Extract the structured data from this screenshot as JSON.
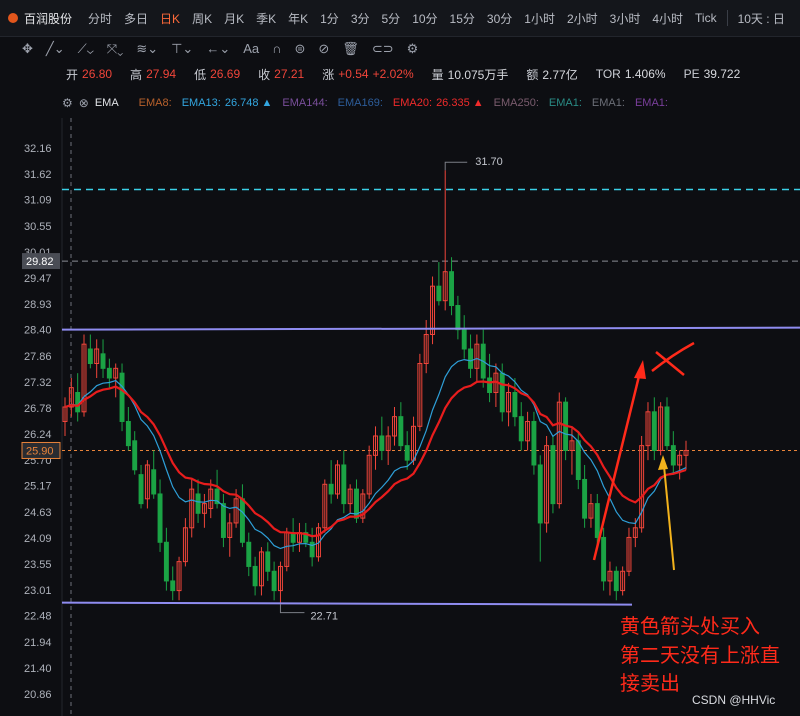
{
  "header": {
    "stock_name": "百润股份",
    "periods": [
      "分时",
      "多日",
      "日K",
      "周K",
      "月K",
      "季K",
      "年K",
      "1分",
      "3分",
      "5分",
      "10分",
      "15分",
      "30分",
      "1小时",
      "2小时",
      "3小时",
      "4小时",
      "Tick"
    ],
    "active_period": "日K",
    "range_label": "10天 : 日"
  },
  "quote": {
    "open_label": "开",
    "open": "26.80",
    "high_label": "高",
    "high": "27.94",
    "low_label": "低",
    "low": "26.69",
    "close_label": "收",
    "close": "27.21",
    "change_label": "涨",
    "change": "+0.54",
    "change_pct": "+2.02%",
    "volume_label": "量",
    "volume": "10.075万手",
    "amount_label": "额",
    "amount": "2.77亿",
    "turnover_label": "TOR",
    "turnover": "1.406%",
    "pe_label": "PE",
    "pe": "39.722"
  },
  "indicator": {
    "name": "EMA",
    "items": [
      {
        "label": "EMA8:",
        "value": "",
        "color": "#b8612c"
      },
      {
        "label": "EMA13:",
        "value": "26.748",
        "color": "#33a6e0",
        "arrow": "▲"
      },
      {
        "label": "EMA144:",
        "value": "",
        "color": "#7a4f9c"
      },
      {
        "label": "EMA169:",
        "value": "",
        "color": "#2d5d9a"
      },
      {
        "label": "EMA20:",
        "value": "26.335",
        "color": "#f02b2b",
        "arrow": "▲"
      },
      {
        "label": "EMA250:",
        "value": "",
        "color": "#7a5c6e"
      },
      {
        "label": "EMA1:",
        "value": "",
        "color": "#2a8c86"
      },
      {
        "label": "EMA1:",
        "value": "",
        "color": "#6c6f78"
      },
      {
        "label": "EMA1:",
        "value": "",
        "color": "#7a3f9c"
      }
    ]
  },
  "colors": {
    "up": "#f0453a",
    "down": "#1ba345",
    "ema13": "#2e9fd8",
    "ema20": "#e81d1d",
    "support": "#8f8cf0",
    "cyan": "#3bd0e6",
    "price": "#e8833a",
    "annot": "#ff2a1a",
    "yellow": "#f2b21c"
  },
  "chart_data": {
    "type": "candlestick",
    "y_ticks": [
      "32.16",
      "31.62",
      "31.09",
      "30.55",
      "30.01",
      "29.47",
      "28.93",
      "28.40",
      "27.86",
      "27.32",
      "26.78",
      "26.24",
      "25.70",
      "25.17",
      "24.63",
      "24.09",
      "23.55",
      "23.01",
      "22.48",
      "21.94",
      "21.40",
      "20.86"
    ],
    "ylim": [
      20.6,
      32.6
    ],
    "current_price": "25.90",
    "crosshair_price": "29.82",
    "high_label": "31.70",
    "low_label": "22.71",
    "h_levels": {
      "resistance": 28.4,
      "support": 22.71,
      "cyan": 31.3,
      "crosshair": 29.82,
      "current": 25.9
    },
    "ohlc": [
      [
        26.5,
        27.0,
        26.2,
        26.8
      ],
      [
        26.8,
        27.4,
        26.6,
        27.2
      ],
      [
        27.1,
        27.5,
        26.5,
        26.7
      ],
      [
        26.7,
        28.3,
        26.6,
        28.1
      ],
      [
        28.0,
        28.3,
        27.6,
        27.7
      ],
      [
        27.7,
        28.2,
        27.4,
        28.0
      ],
      [
        27.9,
        28.2,
        27.4,
        27.6
      ],
      [
        27.6,
        27.8,
        27.2,
        27.4
      ],
      [
        27.4,
        27.7,
        27.0,
        27.6
      ],
      [
        27.5,
        27.7,
        26.3,
        26.5
      ],
      [
        26.5,
        26.8,
        25.9,
        26.0
      ],
      [
        26.1,
        26.3,
        25.4,
        25.5
      ],
      [
        25.4,
        25.6,
        24.7,
        24.8
      ],
      [
        24.9,
        25.7,
        24.7,
        25.6
      ],
      [
        25.5,
        25.9,
        24.9,
        25.0
      ],
      [
        25.0,
        25.3,
        23.8,
        24.0
      ],
      [
        24.0,
        24.3,
        23.0,
        23.2
      ],
      [
        23.2,
        23.5,
        22.8,
        23.0
      ],
      [
        23.0,
        23.7,
        22.8,
        23.6
      ],
      [
        23.6,
        24.5,
        23.5,
        24.3
      ],
      [
        24.3,
        25.3,
        24.1,
        25.1
      ],
      [
        25.0,
        25.3,
        24.4,
        24.6
      ],
      [
        24.6,
        25.0,
        24.3,
        24.8
      ],
      [
        24.7,
        25.3,
        24.5,
        25.1
      ],
      [
        25.1,
        25.5,
        24.7,
        24.8
      ],
      [
        24.8,
        25.0,
        23.9,
        24.1
      ],
      [
        24.1,
        24.6,
        23.7,
        24.4
      ],
      [
        24.4,
        25.1,
        24.3,
        24.9
      ],
      [
        24.9,
        25.2,
        23.9,
        24.0
      ],
      [
        24.0,
        24.2,
        23.3,
        23.5
      ],
      [
        23.5,
        23.7,
        22.9,
        23.1
      ],
      [
        23.1,
        23.9,
        22.9,
        23.8
      ],
      [
        23.8,
        24.0,
        23.2,
        23.4
      ],
      [
        23.4,
        23.6,
        22.8,
        23.0
      ],
      [
        23.0,
        23.6,
        22.71,
        23.5
      ],
      [
        23.5,
        24.3,
        23.4,
        24.2
      ],
      [
        24.2,
        24.5,
        23.8,
        24.0
      ],
      [
        24.0,
        24.4,
        23.8,
        24.2
      ],
      [
        24.2,
        24.4,
        23.9,
        24.0
      ],
      [
        24.0,
        24.3,
        23.5,
        23.7
      ],
      [
        23.7,
        24.4,
        23.6,
        24.3
      ],
      [
        24.3,
        25.3,
        24.2,
        25.2
      ],
      [
        25.2,
        25.7,
        24.8,
        25.0
      ],
      [
        25.0,
        25.7,
        24.9,
        25.6
      ],
      [
        25.6,
        25.9,
        24.6,
        24.8
      ],
      [
        24.8,
        25.2,
        24.6,
        25.1
      ],
      [
        25.1,
        25.3,
        24.4,
        24.5
      ],
      [
        24.5,
        25.1,
        24.4,
        25.0
      ],
      [
        25.0,
        26.0,
        24.9,
        25.8
      ],
      [
        25.8,
        26.4,
        25.5,
        26.2
      ],
      [
        26.2,
        26.6,
        25.7,
        25.9
      ],
      [
        25.9,
        26.4,
        25.6,
        26.2
      ],
      [
        26.2,
        26.8,
        26.0,
        26.6
      ],
      [
        26.6,
        26.9,
        25.9,
        26.0
      ],
      [
        26.0,
        26.3,
        25.5,
        25.7
      ],
      [
        25.7,
        26.6,
        25.6,
        26.4
      ],
      [
        26.4,
        27.9,
        26.3,
        27.7
      ],
      [
        27.7,
        28.6,
        27.5,
        28.3
      ],
      [
        28.3,
        29.5,
        28.1,
        29.3
      ],
      [
        29.3,
        29.8,
        28.9,
        29.0
      ],
      [
        29.0,
        31.7,
        28.8,
        29.6
      ],
      [
        29.6,
        29.9,
        28.7,
        28.9
      ],
      [
        28.9,
        29.1,
        28.2,
        28.4
      ],
      [
        28.4,
        28.7,
        27.8,
        28.0
      ],
      [
        28.0,
        28.3,
        27.4,
        27.6
      ],
      [
        27.6,
        28.3,
        27.3,
        28.1
      ],
      [
        28.1,
        28.4,
        27.2,
        27.4
      ],
      [
        27.4,
        27.9,
        26.9,
        27.1
      ],
      [
        27.1,
        27.7,
        26.8,
        27.5
      ],
      [
        27.5,
        27.7,
        26.5,
        26.7
      ],
      [
        26.7,
        27.3,
        26.4,
        27.1
      ],
      [
        27.1,
        27.4,
        26.4,
        26.6
      ],
      [
        26.6,
        26.9,
        25.9,
        26.1
      ],
      [
        26.1,
        26.7,
        25.9,
        26.5
      ],
      [
        26.5,
        26.7,
        25.4,
        25.6
      ],
      [
        25.6,
        25.8,
        23.6,
        24.4
      ],
      [
        24.4,
        26.2,
        24.2,
        26.0
      ],
      [
        26.0,
        26.2,
        24.6,
        24.8
      ],
      [
        24.8,
        27.1,
        24.7,
        26.9
      ],
      [
        26.9,
        27.0,
        25.7,
        25.9
      ],
      [
        25.9,
        26.4,
        25.4,
        26.1
      ],
      [
        26.1,
        26.3,
        25.1,
        25.3
      ],
      [
        25.3,
        25.6,
        24.3,
        24.5
      ],
      [
        24.5,
        25.0,
        24.3,
        24.8
      ],
      [
        24.8,
        25.0,
        23.9,
        24.1
      ],
      [
        24.1,
        24.3,
        23.0,
        23.2
      ],
      [
        23.2,
        23.6,
        22.9,
        23.4
      ],
      [
        23.4,
        23.5,
        22.8,
        23.0
      ],
      [
        23.0,
        23.5,
        22.9,
        23.4
      ],
      [
        23.4,
        24.3,
        23.3,
        24.1
      ],
      [
        24.1,
        24.5,
        23.9,
        24.3
      ],
      [
        24.3,
        26.2,
        24.2,
        26.0
      ],
      [
        26.0,
        26.9,
        25.7,
        26.7
      ],
      [
        26.7,
        27.0,
        25.7,
        25.9
      ],
      [
        25.9,
        26.9,
        25.8,
        26.8
      ],
      [
        26.8,
        27.0,
        25.9,
        26.0
      ],
      [
        26.0,
        26.3,
        25.4,
        25.6
      ],
      [
        25.6,
        25.9,
        25.3,
        25.8
      ],
      [
        25.8,
        26.1,
        25.5,
        25.9
      ]
    ]
  },
  "annotations": {
    "text_lines": [
      "黄色箭头处买入",
      "第二天没有上涨直",
      "接卖出"
    ],
    "watermark": "CSDN @HHVic"
  }
}
